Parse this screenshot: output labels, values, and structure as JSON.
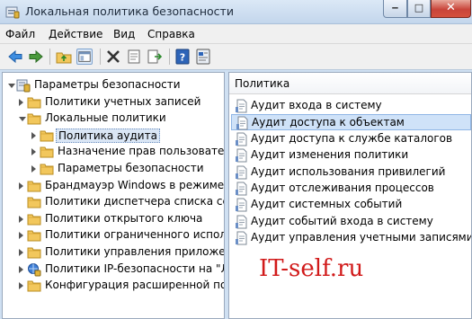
{
  "window": {
    "title": "Локальная политика безопасности",
    "app_icon": "security-policy-icon",
    "controls": [
      "minimize-icon",
      "maximize-icon",
      "close-icon"
    ]
  },
  "menu": [
    "Файл",
    "Действие",
    "Вид",
    "Справка"
  ],
  "toolbar": [
    "back-arrow-icon",
    "forward-arrow-icon",
    "up-folder-icon",
    "show-hide-tree-icon",
    "delete-icon",
    "properties-icon",
    "export-list-icon",
    "help-icon",
    "help-topic-icon"
  ],
  "tree": [
    {
      "label": "Параметры безопасности",
      "icon": "security-settings-icon",
      "state": "open",
      "level": 0
    },
    {
      "label": "Политики учетных записей",
      "icon": "folder-icon",
      "state": "closed",
      "level": 1
    },
    {
      "label": "Локальные политики",
      "icon": "folder-icon",
      "state": "open",
      "level": 1
    },
    {
      "label": "Политика аудита",
      "icon": "folder-icon",
      "state": "closed",
      "level": 2,
      "selected": true
    },
    {
      "label": "Назначение прав пользователя",
      "icon": "folder-icon",
      "state": "closed",
      "level": 2
    },
    {
      "label": "Параметры безопасности",
      "icon": "folder-icon",
      "state": "closed",
      "level": 2
    },
    {
      "label": "Брандмауэр Windows в режиме пов",
      "icon": "folder-icon",
      "state": "closed",
      "level": 1
    },
    {
      "label": "Политики диспетчера списка сетей",
      "icon": "folder-icon",
      "state": "none",
      "level": 1
    },
    {
      "label": "Политики открытого ключа",
      "icon": "folder-icon",
      "state": "closed",
      "level": 1
    },
    {
      "label": "Политики ограниченного использо",
      "icon": "folder-icon",
      "state": "closed",
      "level": 1
    },
    {
      "label": "Политики управления приложения",
      "icon": "folder-icon",
      "state": "closed",
      "level": 1
    },
    {
      "label": "Политики IP-безопасности на \"Лока",
      "icon": "ip-security-icon",
      "state": "closed",
      "level": 1
    },
    {
      "label": "Конфигурация расширенной полити",
      "icon": "folder-icon",
      "state": "closed",
      "level": 1
    }
  ],
  "list": {
    "header": "Политика",
    "items": [
      {
        "label": "Аудит входа в систему",
        "icon": "policy-icon",
        "selected": false
      },
      {
        "label": "Аудит доступа к объектам",
        "icon": "policy-icon",
        "selected": true
      },
      {
        "label": "Аудит доступа к службе каталогов",
        "icon": "policy-icon",
        "selected": false
      },
      {
        "label": "Аудит изменения политики",
        "icon": "policy-icon",
        "selected": false
      },
      {
        "label": "Аудит использования привилегий",
        "icon": "policy-icon",
        "selected": false
      },
      {
        "label": "Аудит отслеживания процессов",
        "icon": "policy-icon",
        "selected": false
      },
      {
        "label": "Аудит системных событий",
        "icon": "policy-icon",
        "selected": false
      },
      {
        "label": "Аудит событий входа в систему",
        "icon": "policy-icon",
        "selected": false
      },
      {
        "label": "Аудит управления учетными записями",
        "icon": "policy-icon",
        "selected": false
      }
    ]
  },
  "watermark": "IT-self.ru",
  "colors": {
    "selection": "#cfe2f8",
    "folder": "#f2c75c",
    "watermark": "#d11a1a"
  }
}
